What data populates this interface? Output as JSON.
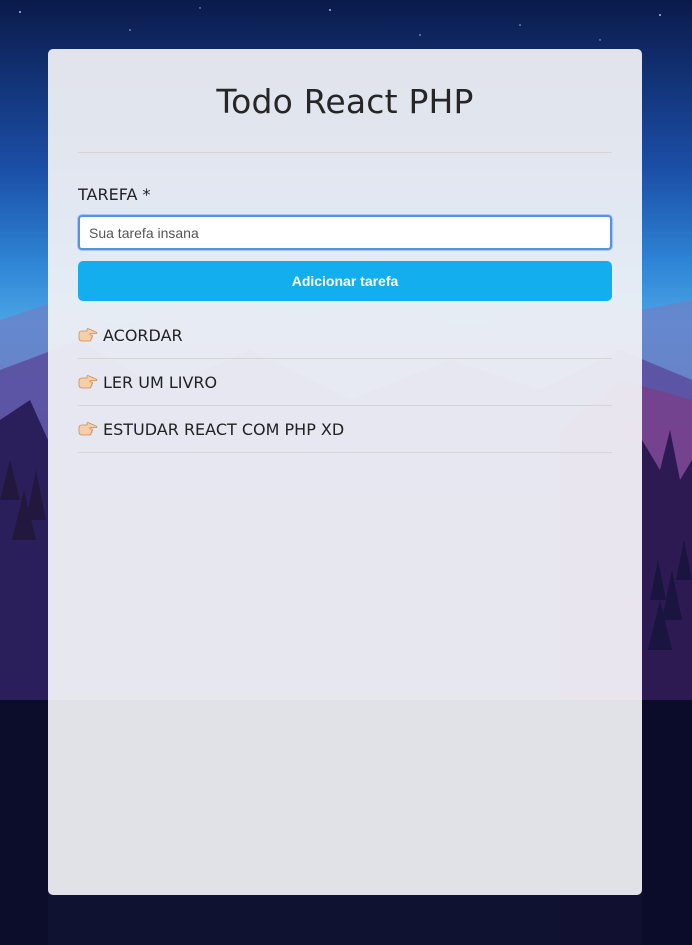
{
  "app": {
    "title": "Todo React PHP"
  },
  "form": {
    "label": "TAREFA *",
    "input_placeholder": "Sua tarefa insana",
    "input_value": "",
    "submit_label": "Adicionar tarefa"
  },
  "tasks": [
    {
      "text": "ACORDAR",
      "icon": "pointing-hand-icon"
    },
    {
      "text": "LER UM LIVRO",
      "icon": "pointing-hand-icon"
    },
    {
      "text": "ESTUDAR REACT COM PHP XD",
      "icon": "pointing-hand-icon"
    }
  ],
  "colors": {
    "accent": "#12aeee",
    "input_focus": "#5b8fe6",
    "card_bg": "#f1f2f5"
  }
}
